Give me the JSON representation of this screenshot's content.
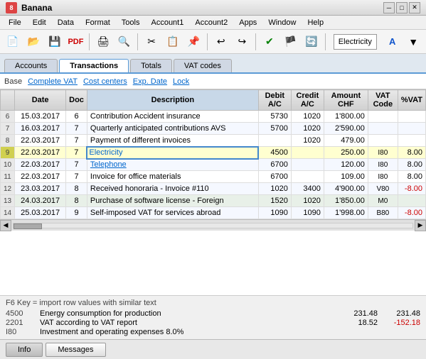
{
  "app": {
    "title": "Banana",
    "icon": "8"
  },
  "titlebar": {
    "title": "Banana",
    "minimize": "─",
    "restore": "□",
    "close": "✕"
  },
  "menu": {
    "items": [
      "File",
      "Edit",
      "Data",
      "Format",
      "Tools",
      "Account1",
      "Account2",
      "Apps",
      "Window",
      "Help"
    ]
  },
  "addressbar": {
    "text": "Electricity"
  },
  "tabs": [
    {
      "label": "Accounts",
      "active": false
    },
    {
      "label": "Transactions",
      "active": true
    },
    {
      "label": "Totals",
      "active": false
    },
    {
      "label": "VAT codes",
      "active": false
    }
  ],
  "navbar": {
    "base": "Base",
    "complete_vat": "Complete VAT",
    "cost_centers": "Cost centers",
    "exp_date": "Exp. Date",
    "lock": "Lock"
  },
  "table": {
    "headers": [
      "",
      "Date",
      "Doc",
      "Description",
      "Debit A/C",
      "Credit A/C",
      "Amount CHF",
      "VAT Code",
      "%VAT"
    ],
    "rows": [
      {
        "num": "6",
        "date": "15.03.2017",
        "doc": "6",
        "desc": "Contribution Accident insurance",
        "debit": "5730",
        "credit": "1020",
        "amount": "1'800.00",
        "vat_code": "",
        "vat_pct": "",
        "style": "even",
        "desc_style": "normal"
      },
      {
        "num": "7",
        "date": "16.03.2017",
        "doc": "7",
        "desc": "Quarterly anticipated contributions AVS",
        "debit": "5700",
        "credit": "1020",
        "amount": "2'590.00",
        "vat_code": "",
        "vat_pct": "",
        "style": "odd",
        "desc_style": "normal"
      },
      {
        "num": "8",
        "date": "22.03.2017",
        "doc": "7",
        "desc": "Payment of different invoices",
        "debit": "",
        "credit": "1020",
        "amount": "479.00",
        "vat_code": "",
        "vat_pct": "",
        "style": "even",
        "desc_style": "normal"
      },
      {
        "num": "9",
        "date": "22.03.2017",
        "doc": "7",
        "desc": "Electricity",
        "debit": "4500",
        "credit": "",
        "amount": "250.00",
        "vat_code": "I80",
        "vat_pct": "8.00",
        "style": "selected",
        "desc_style": "editing"
      },
      {
        "num": "10",
        "date": "22.03.2017",
        "doc": "7",
        "desc": "Telephone",
        "debit": "6700",
        "credit": "",
        "amount": "120.00",
        "vat_code": "I80",
        "vat_pct": "8.00",
        "style": "odd",
        "desc_style": "link"
      },
      {
        "num": "11",
        "date": "22.03.2017",
        "doc": "7",
        "desc": "Invoice for office materials",
        "debit": "6700",
        "credit": "",
        "amount": "109.00",
        "vat_code": "I80",
        "vat_pct": "8.00",
        "style": "even",
        "desc_style": "normal"
      },
      {
        "num": "12",
        "date": "23.03.2017",
        "doc": "8",
        "desc": "Received honoraria - Invoice #110",
        "debit": "1020",
        "credit": "3400",
        "amount": "4'900.00",
        "vat_code": "V80",
        "vat_pct": "-8.00",
        "style": "odd",
        "desc_style": "normal"
      },
      {
        "num": "13",
        "date": "24.03.2017",
        "doc": "8",
        "desc": "Purchase of software license - Foreign",
        "debit": "1520",
        "credit": "1020",
        "amount": "1'850.00",
        "vat_code": "M0",
        "vat_pct": "",
        "style": "highlight",
        "desc_style": "normal"
      },
      {
        "num": "14",
        "date": "25.03.2017",
        "doc": "9",
        "desc": "Self-imposed VAT for services abroad",
        "debit": "1090",
        "credit": "1090",
        "amount": "1'998.00",
        "vat_code": "B80",
        "vat_pct": "-8.00",
        "style": "odd",
        "desc_style": "normal"
      }
    ]
  },
  "status": {
    "hint": "F6 Key = import row values with similar text",
    "entries": [
      {
        "code": "4500",
        "label": "Energy consumption for production",
        "val1": "231.48",
        "val2": "231.48"
      },
      {
        "code": "2201",
        "label": "VAT according to VAT report",
        "val1": "18.52",
        "val2": "-152.18"
      },
      {
        "code": "I80",
        "label": "Investment and operating expenses 8.0%",
        "val1": "",
        "val2": ""
      }
    ]
  },
  "bottom": {
    "info": "Info",
    "messages": "Messages"
  }
}
